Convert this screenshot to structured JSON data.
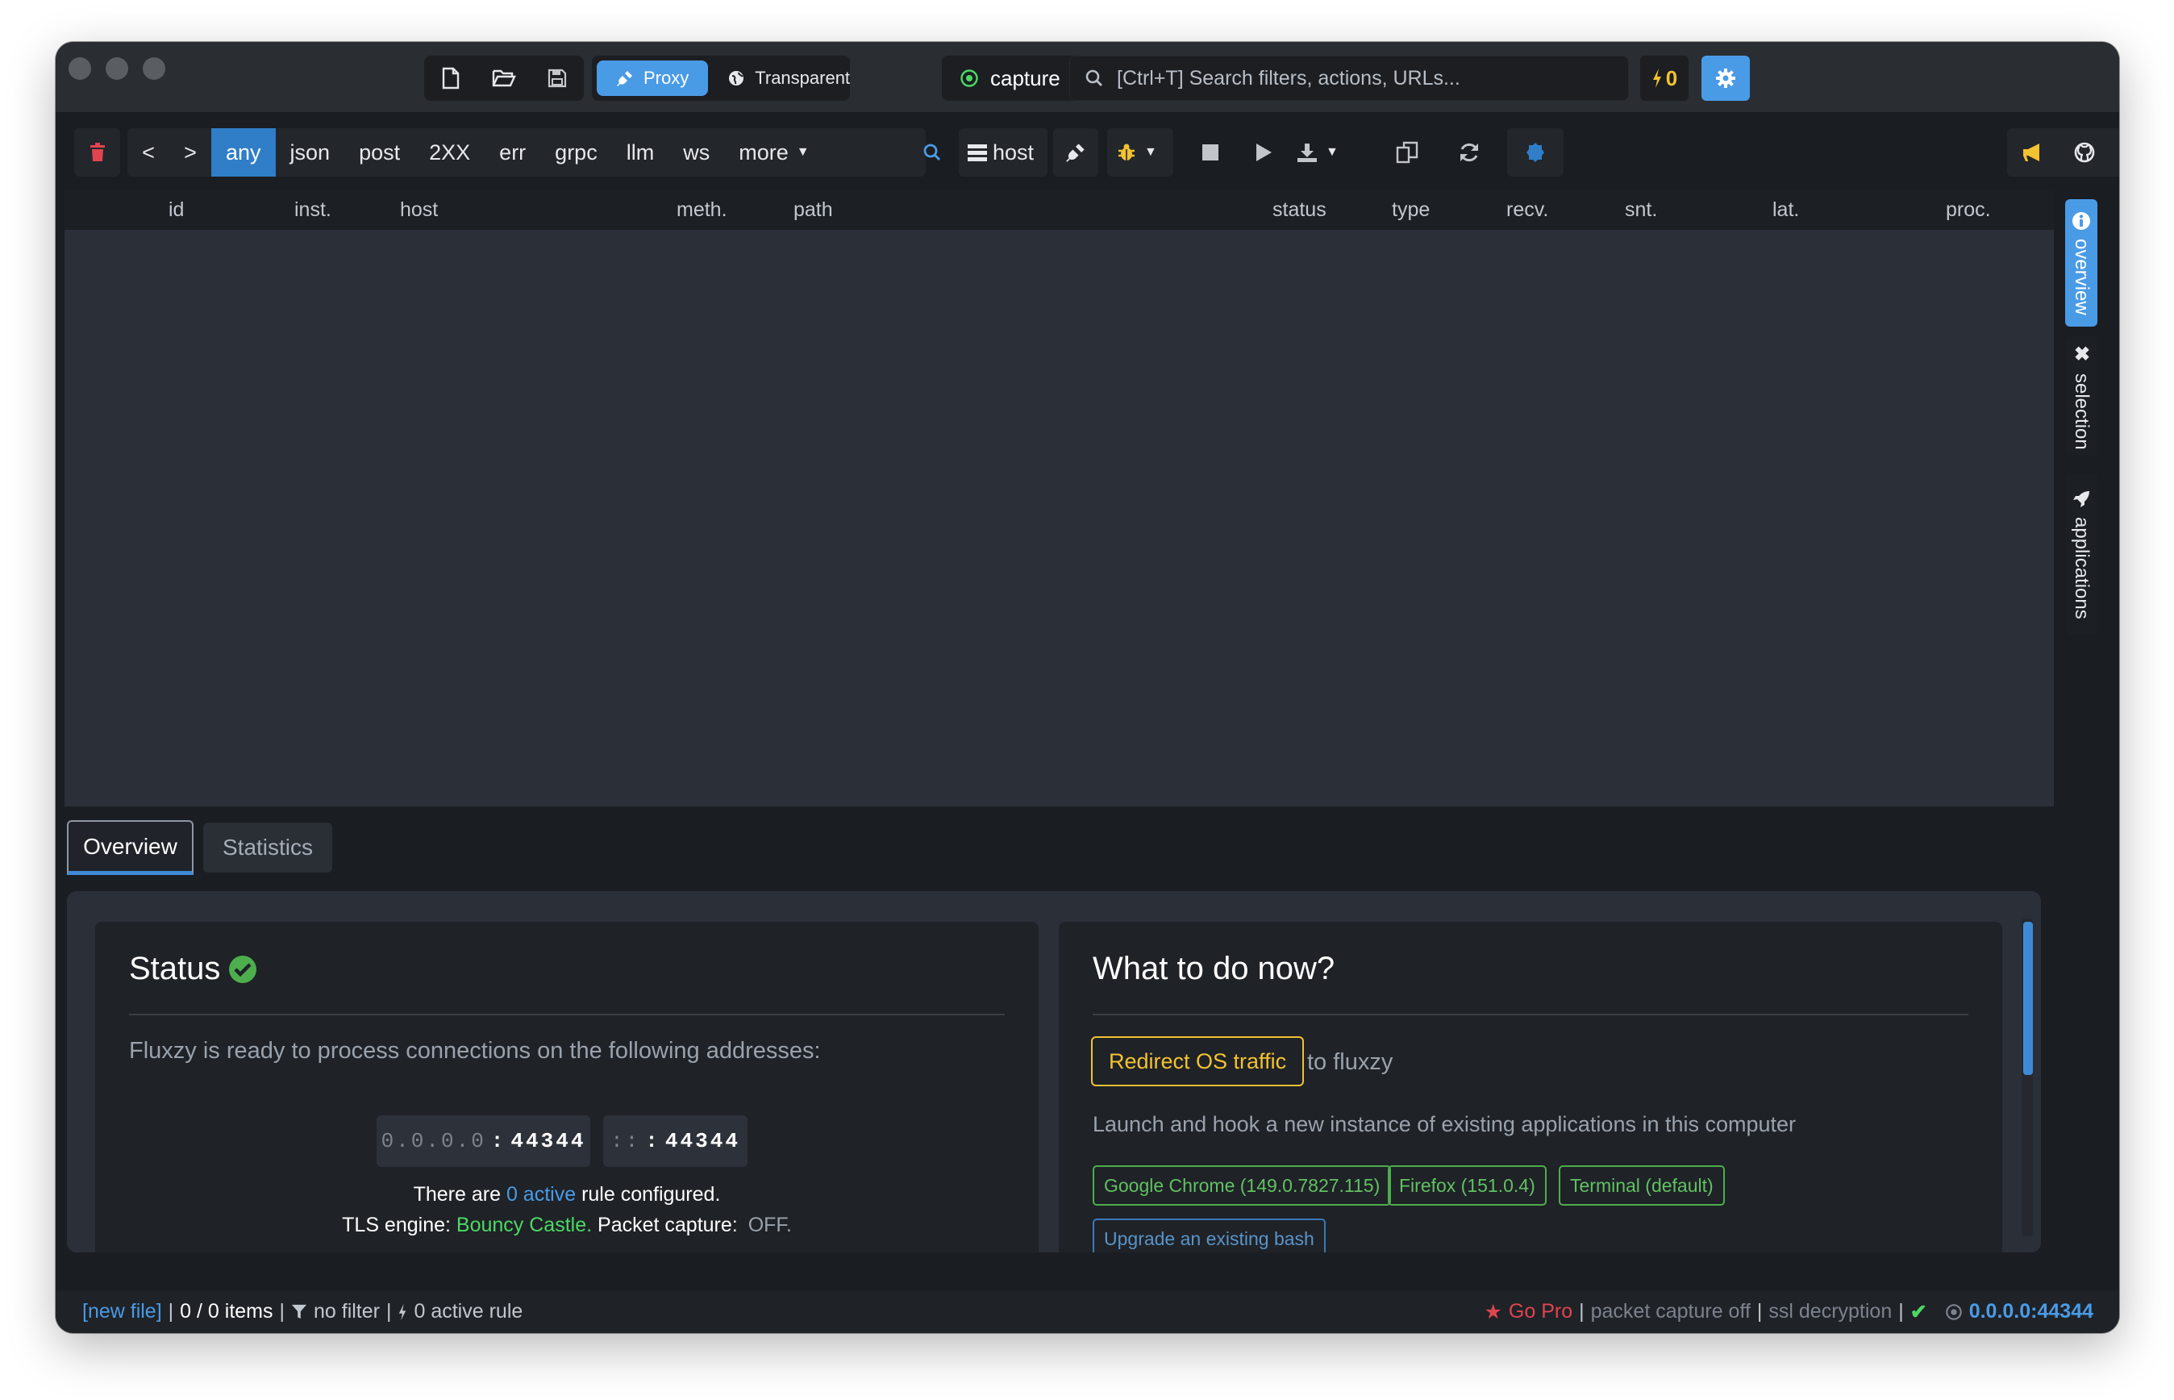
{
  "titlebar": {
    "modes": {
      "proxy": "Proxy",
      "transparent": "Transparent"
    },
    "capture": "capture",
    "search": {
      "placeholder": "[Ctrl+T] Search filters, actions, URLs..."
    },
    "bolt_count": "0"
  },
  "toolbar": {
    "filters": [
      "any",
      "json",
      "post",
      "2XX",
      "err",
      "grpc",
      "llm",
      "ws"
    ],
    "more": "more",
    "host_label": "host",
    "back": "<",
    "forward": ">"
  },
  "table": {
    "columns": [
      "id",
      "inst.",
      "host",
      "meth.",
      "path",
      "status",
      "type",
      "recv.",
      "snt.",
      "lat.",
      "proc."
    ]
  },
  "side_tabs": [
    "overview",
    "selection",
    "applications"
  ],
  "bottom_tabs": {
    "overview": "Overview",
    "statistics": "Statistics"
  },
  "status_card": {
    "title": "Status",
    "description": "Fluxzy is ready to process connections on the following addresses:",
    "addresses": [
      {
        "ip": "0.0.0.0",
        "port": "44344"
      },
      {
        "ip": "::",
        "port": "44344"
      }
    ],
    "rules_prefix": "There are",
    "rules_link": "0 active",
    "rules_suffix": "rule configured.",
    "tls_label": "TLS engine:",
    "tls_value": "Bouncy Castle.",
    "packet_label": "Packet capture:",
    "packet_value": "OFF."
  },
  "todo_card": {
    "title": "What to do now?",
    "redirect_button": "Redirect OS traffic",
    "redirect_suffix": "to fluxzy",
    "launch_text": "Launch and hook a new instance of existing applications in this computer",
    "apps": [
      "Google Chrome (149.0.7827.115)",
      "Firefox (151.0.4)",
      "Terminal (default)"
    ],
    "upgrade": "Upgrade an existing bash"
  },
  "statusbar": {
    "file": "[new file]",
    "items": "0 / 0 items",
    "filter": "no filter",
    "rules": "0 active rule",
    "go_pro": "Go Pro",
    "packet_capture": "packet capture off",
    "ssl": "ssl decryption",
    "endpoint": "0.0.0.0:44344"
  },
  "colors": {
    "accent": "#4a9be6",
    "success": "#4cae4c",
    "warning": "#f2c230",
    "danger": "#e0444f",
    "link": "#4a9be6"
  }
}
